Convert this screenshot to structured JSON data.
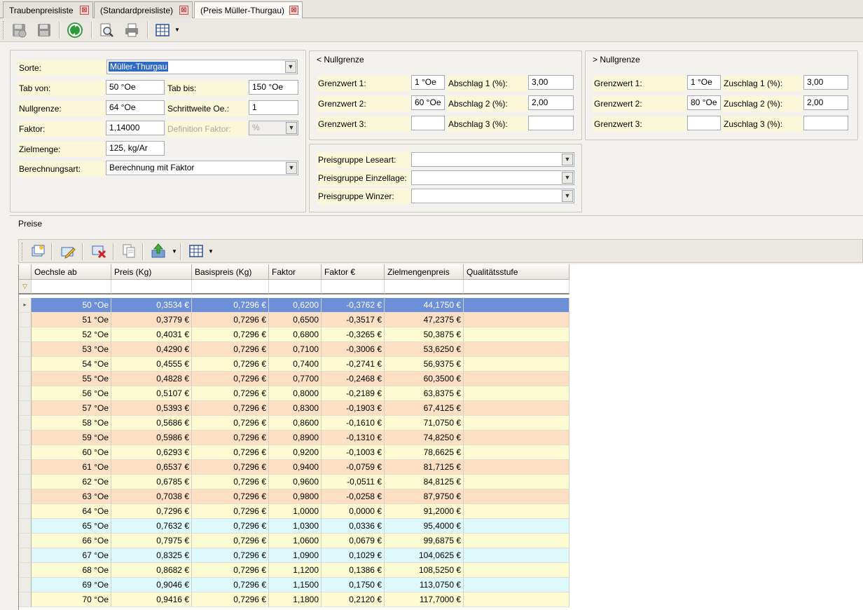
{
  "tabs": [
    {
      "label": "Traubenpreisliste",
      "close": "⊠"
    },
    {
      "label": "(Standardpreisliste)",
      "close": "⊠"
    },
    {
      "label": "(Preis Müller-Thurgau)",
      "close": "⊠"
    }
  ],
  "form": {
    "sorte_label": "Sorte:",
    "sorte_value": "Müller-Thurgau",
    "tab_von_label": "Tab von:",
    "tab_von_value": "50 °Oe",
    "tab_bis_label": "Tab bis:",
    "tab_bis_value": "150 °Oe",
    "nullgrenze_label": "Nullgrenze:",
    "nullgrenze_value": "64 °Oe",
    "schrittweite_label": "Schrittweite Oe.:",
    "schrittweite_value": "1",
    "faktor_label": "Faktor:",
    "faktor_value": "1,14000",
    "def_faktor_label": "Definition Faktor:",
    "def_faktor_value": "%",
    "zielmenge_label": "Zielmenge:",
    "zielmenge_value": "125, kg/Ar",
    "berechnungsart_label": "Berechnungsart:",
    "berechnungsart_value": "Berechnung mit Faktor"
  },
  "lower": {
    "title": "< Nullgrenze",
    "rows": [
      {
        "g_label": "Grenzwert 1:",
        "g_value": "1 °Oe",
        "a_label": "Abschlag 1 (%):",
        "a_value": "3,00"
      },
      {
        "g_label": "Grenzwert 2:",
        "g_value": "60 °Oe",
        "a_label": "Abschlag 2 (%):",
        "a_value": "2,00"
      },
      {
        "g_label": "Grenzwert 3:",
        "g_value": "",
        "a_label": "Abschlag 3 (%):",
        "a_value": ""
      }
    ]
  },
  "upper": {
    "title": "> Nullgrenze",
    "rows": [
      {
        "g_label": "Grenzwert 1:",
        "g_value": "1 °Oe",
        "a_label": "Zuschlag 1 (%):",
        "a_value": "3,00"
      },
      {
        "g_label": "Grenzwert 2:",
        "g_value": "80 °Oe",
        "a_label": "Zuschlag 2 (%):",
        "a_value": "2,00"
      },
      {
        "g_label": "Grenzwert 3:",
        "g_value": "",
        "a_label": "Zuschlag 3 (%):",
        "a_value": ""
      }
    ]
  },
  "preisgruppen": {
    "leseart_label": "Preisgruppe Leseart:",
    "einzellage_label": "Preisgruppe Einzellage:",
    "winzer_label": "Preisgruppe Winzer:"
  },
  "preise": {
    "title": "Preise",
    "columns": [
      "Oechsle ab",
      "Preis (Kg)",
      "Basispreis (Kg)",
      "Faktor",
      "Faktor €",
      "Zielmengenpreis",
      "Qualitätsstufe"
    ],
    "row_colors": {
      "selected": "#6d8fd8",
      "peach": "#fde0c4",
      "yellow": "#fdfbd2",
      "cyan": "#def9fb"
    },
    "rows": [
      {
        "oe": "50 °Oe",
        "preis": "0,3534 €",
        "basis": "0,7296 €",
        "faktor": "0,6200",
        "faktor_eur": "-0,3762 €",
        "ziel": "44,1750 €",
        "q": "",
        "tone": "selected"
      },
      {
        "oe": "51 °Oe",
        "preis": "0,3779 €",
        "basis": "0,7296 €",
        "faktor": "0,6500",
        "faktor_eur": "-0,3517 €",
        "ziel": "47,2375 €",
        "q": "",
        "tone": "peach"
      },
      {
        "oe": "52 °Oe",
        "preis": "0,4031 €",
        "basis": "0,7296 €",
        "faktor": "0,6800",
        "faktor_eur": "-0,3265 €",
        "ziel": "50,3875 €",
        "q": "",
        "tone": "yellow"
      },
      {
        "oe": "53 °Oe",
        "preis": "0,4290 €",
        "basis": "0,7296 €",
        "faktor": "0,7100",
        "faktor_eur": "-0,3006 €",
        "ziel": "53,6250 €",
        "q": "",
        "tone": "peach"
      },
      {
        "oe": "54 °Oe",
        "preis": "0,4555 €",
        "basis": "0,7296 €",
        "faktor": "0,7400",
        "faktor_eur": "-0,2741 €",
        "ziel": "56,9375 €",
        "q": "",
        "tone": "yellow"
      },
      {
        "oe": "55 °Oe",
        "preis": "0,4828 €",
        "basis": "0,7296 €",
        "faktor": "0,7700",
        "faktor_eur": "-0,2468 €",
        "ziel": "60,3500 €",
        "q": "",
        "tone": "peach"
      },
      {
        "oe": "56 °Oe",
        "preis": "0,5107 €",
        "basis": "0,7296 €",
        "faktor": "0,8000",
        "faktor_eur": "-0,2189 €",
        "ziel": "63,8375 €",
        "q": "",
        "tone": "yellow"
      },
      {
        "oe": "57 °Oe",
        "preis": "0,5393 €",
        "basis": "0,7296 €",
        "faktor": "0,8300",
        "faktor_eur": "-0,1903 €",
        "ziel": "67,4125 €",
        "q": "",
        "tone": "peach"
      },
      {
        "oe": "58 °Oe",
        "preis": "0,5686 €",
        "basis": "0,7296 €",
        "faktor": "0,8600",
        "faktor_eur": "-0,1610 €",
        "ziel": "71,0750 €",
        "q": "",
        "tone": "yellow"
      },
      {
        "oe": "59 °Oe",
        "preis": "0,5986 €",
        "basis": "0,7296 €",
        "faktor": "0,8900",
        "faktor_eur": "-0,1310 €",
        "ziel": "74,8250 €",
        "q": "",
        "tone": "peach"
      },
      {
        "oe": "60 °Oe",
        "preis": "0,6293 €",
        "basis": "0,7296 €",
        "faktor": "0,9200",
        "faktor_eur": "-0,1003 €",
        "ziel": "78,6625 €",
        "q": "",
        "tone": "yellow"
      },
      {
        "oe": "61 °Oe",
        "preis": "0,6537 €",
        "basis": "0,7296 €",
        "faktor": "0,9400",
        "faktor_eur": "-0,0759 €",
        "ziel": "81,7125 €",
        "q": "",
        "tone": "peach"
      },
      {
        "oe": "62 °Oe",
        "preis": "0,6785 €",
        "basis": "0,7296 €",
        "faktor": "0,9600",
        "faktor_eur": "-0,0511 €",
        "ziel": "84,8125 €",
        "q": "",
        "tone": "yellow"
      },
      {
        "oe": "63 °Oe",
        "preis": "0,7038 €",
        "basis": "0,7296 €",
        "faktor": "0,9800",
        "faktor_eur": "-0,0258 €",
        "ziel": "87,9750 €",
        "q": "",
        "tone": "peach"
      },
      {
        "oe": "64 °Oe",
        "preis": "0,7296 €",
        "basis": "0,7296 €",
        "faktor": "1,0000",
        "faktor_eur": "0,0000 €",
        "ziel": "91,2000 €",
        "q": "",
        "tone": "yellow"
      },
      {
        "oe": "65 °Oe",
        "preis": "0,7632 €",
        "basis": "0,7296 €",
        "faktor": "1,0300",
        "faktor_eur": "0,0336 €",
        "ziel": "95,4000 €",
        "q": "",
        "tone": "cyan"
      },
      {
        "oe": "66 °Oe",
        "preis": "0,7975 €",
        "basis": "0,7296 €",
        "faktor": "1,0600",
        "faktor_eur": "0,0679 €",
        "ziel": "99,6875 €",
        "q": "",
        "tone": "yellow"
      },
      {
        "oe": "67 °Oe",
        "preis": "0,8325 €",
        "basis": "0,7296 €",
        "faktor": "1,0900",
        "faktor_eur": "0,1029 €",
        "ziel": "104,0625 €",
        "q": "",
        "tone": "cyan"
      },
      {
        "oe": "68 °Oe",
        "preis": "0,8682 €",
        "basis": "0,7296 €",
        "faktor": "1,1200",
        "faktor_eur": "0,1386 €",
        "ziel": "108,5250 €",
        "q": "",
        "tone": "yellow"
      },
      {
        "oe": "69 °Oe",
        "preis": "0,9046 €",
        "basis": "0,7296 €",
        "faktor": "1,1500",
        "faktor_eur": "0,1750 €",
        "ziel": "113,0750 €",
        "q": "",
        "tone": "cyan"
      },
      {
        "oe": "70 °Oe",
        "preis": "0,9416 €",
        "basis": "0,7296 €",
        "faktor": "1,1800",
        "faktor_eur": "0,2120 €",
        "ziel": "117,7000 €",
        "q": "",
        "tone": "yellow"
      }
    ]
  }
}
